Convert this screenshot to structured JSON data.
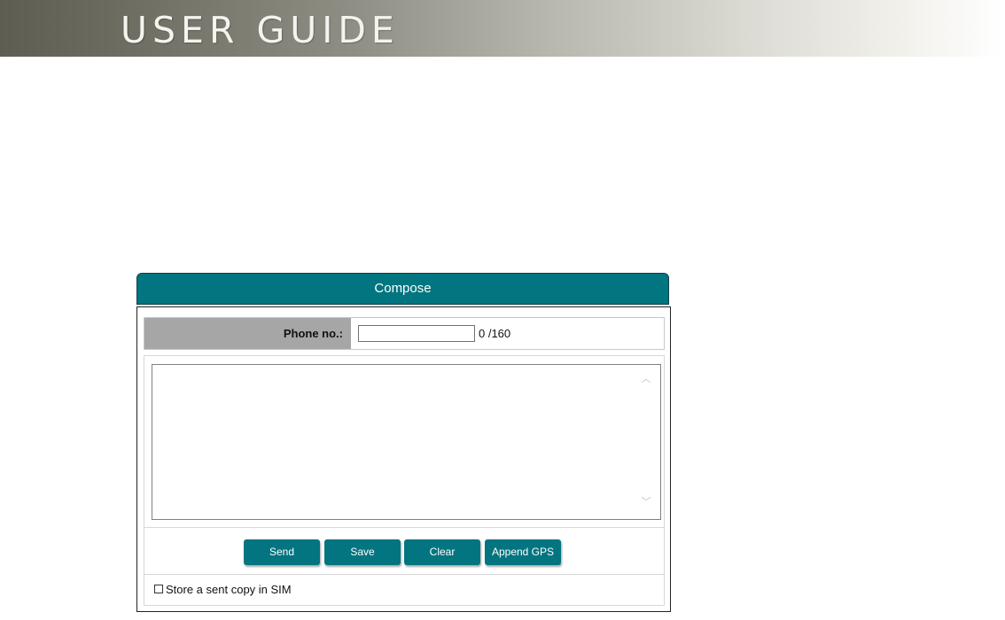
{
  "banner": {
    "title": "USER GUIDE"
  },
  "compose": {
    "title": "Compose",
    "phone_label": "Phone no.:",
    "phone_value": "",
    "counter": "0 /160",
    "message_value": "",
    "buttons": {
      "send": "Send",
      "save": "Save",
      "clear": "Clear",
      "append_gps": "Append GPS"
    },
    "store_copy_label": "Store a sent copy in SIM",
    "store_copy_checked": false
  },
  "colors": {
    "accent": "#037580",
    "label_cell": "#a6a6a6"
  },
  "icons": {
    "scroll_up": "scroll-up-arrow-icon",
    "scroll_down": "scroll-down-arrow-icon"
  }
}
